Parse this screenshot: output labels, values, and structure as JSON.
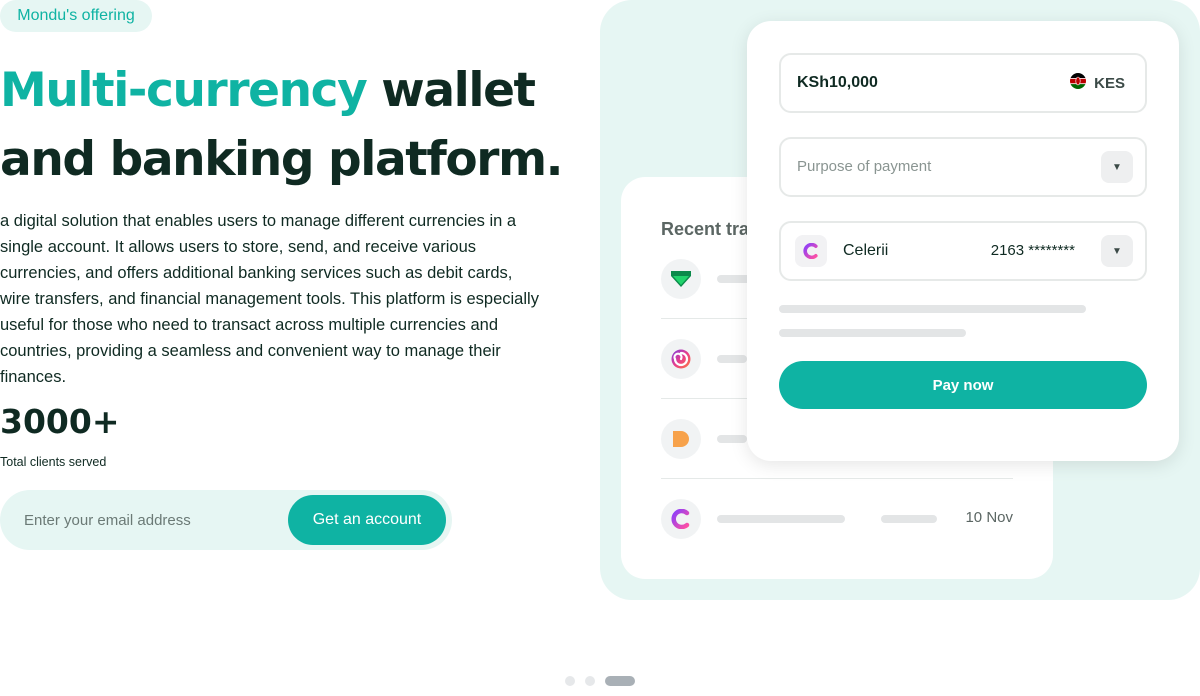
{
  "badge": "Mondu's offering",
  "headline": {
    "accent": "Multi-currency",
    "rest_line1": " wallet",
    "line2": "and banking platform."
  },
  "description": "a digital solution that enables users to manage different currencies in a single account. It allows users to store, send, and receive various currencies, and offers additional banking services such as debit cards, wire transfers, and financial management tools. This platform is especially useful for those who need to transact across multiple currencies and countries, providing a seamless and convenient way to manage their finances.",
  "stats": {
    "value": "3000+",
    "label": "Total clients served"
  },
  "signup": {
    "placeholder": "Enter your email address",
    "button": "Get an account"
  },
  "recent": {
    "title": "Recent tra",
    "transactions": [
      {
        "icon": "green-shield-logo-icon",
        "date": ""
      },
      {
        "icon": "gradient-swirl-logo-icon",
        "date": ""
      },
      {
        "icon": "orange-d-logo-icon",
        "date": ""
      },
      {
        "icon": "celerii-logo-icon",
        "date": "10 Nov"
      }
    ]
  },
  "payment": {
    "amount": "KSh10,000",
    "currency": "KES",
    "currency_flag": "kenya-flag-icon",
    "purpose_placeholder": "Purpose of payment",
    "bank_name": "Celerii",
    "account": "2163 ********",
    "pay_button": "Pay now"
  },
  "carousel": {
    "count": 3,
    "active_index": 2
  },
  "colors": {
    "accent": "#0fb3a3",
    "mint": "#e6f6f3",
    "dark_text": "#0f2a22"
  }
}
